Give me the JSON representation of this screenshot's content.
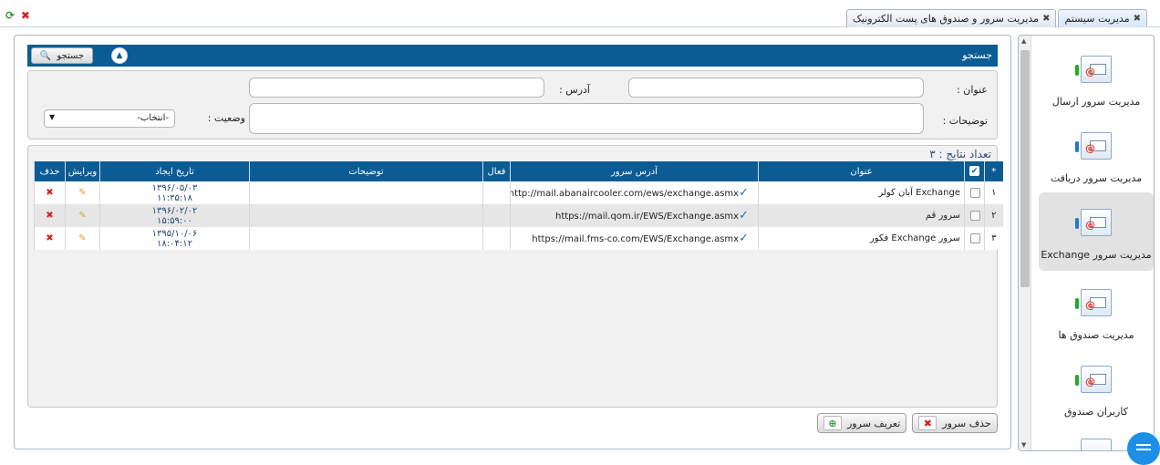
{
  "tabs": [
    {
      "label": "مدیریت سیستم",
      "active": true
    },
    {
      "label": "مدیریت سرور و صندوق های پست الکترونیک",
      "active": false
    }
  ],
  "sidebar": {
    "items": [
      {
        "label": "مدیریت سرور ارسال",
        "active": false,
        "mark_color": "#22aa22"
      },
      {
        "label": "مدیریت سرور دریافت",
        "active": false,
        "mark_color": "#2277cc"
      },
      {
        "label": "مدیریت سرور Exchange",
        "active": true,
        "mark_color": "#2277cc"
      },
      {
        "label": "مدیریت صندوق ها",
        "active": false,
        "mark_color": "#22aa22"
      },
      {
        "label": "کاربران صندوق",
        "active": false,
        "mark_color": "#22aa22"
      }
    ]
  },
  "search": {
    "title": "جستجو",
    "button_label": "جستجو",
    "fields": {
      "title_label": "عنوان :",
      "address_label": "آدرس :",
      "description_label": "توضیحات :",
      "status_label": "وضعیت :",
      "status_value": "-انتخاب-"
    }
  },
  "results": {
    "count_text": "تعداد نتایج : ۳",
    "columns": [
      "*",
      "",
      "عنوان",
      "آدرس سرور",
      "فعال",
      "توضیحات",
      "تاریخ ایجاد",
      "ویرایش",
      "حذف"
    ],
    "rows": [
      {
        "num": "۱",
        "title": "Exchange آبان کولر",
        "address": "http://mail.abanaircooler.com/ews/exchange.asmx",
        "description": "",
        "date": "۱۳۹۶/۰۵/۰۳",
        "time": "۱۱:۳۵:۱۸"
      },
      {
        "num": "۲",
        "title": "سرور قم",
        "address": "https://mail.qom.ir/EWS/Exchange.asmx",
        "description": "",
        "date": "۱۳۹۶/۰۲/۰۲",
        "time": "۱۵:۵۹:۰۰"
      },
      {
        "num": "۳",
        "title": "سرور Exchange فکور",
        "address": "https://mail.fms-co.com/EWS/Exchange.asmx",
        "description": "",
        "date": "۱۳۹۵/۱۰/۰۶",
        "time": "۱۸:۰۴:۱۲"
      }
    ]
  },
  "actions": {
    "delete_label": "حذف سرور",
    "define_label": "تعریف سرور"
  },
  "colors": {
    "header_blue": "#0b5c94",
    "accent_red": "#d42020",
    "accent_green": "#2e9a2e"
  }
}
